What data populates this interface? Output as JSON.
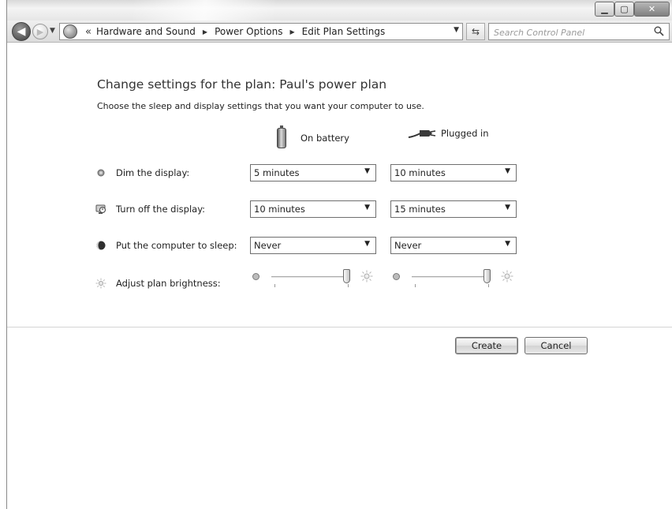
{
  "window": {
    "controls": {
      "minimize_icon": "minimize-icon",
      "maximize_icon": "maximize-icon",
      "close_icon": "close-icon"
    }
  },
  "nav": {
    "breadcrumb_prefix": "«",
    "breadcrumbs": [
      "Hardware and Sound",
      "Power Options",
      "Edit Plan Settings"
    ],
    "search_placeholder": "Search Control Panel"
  },
  "page": {
    "title": "Change settings for the plan: Paul's power plan",
    "subtitle": "Choose the sleep and display settings that you want your computer to use."
  },
  "columns": {
    "battery": "On battery",
    "plugged": "Plugged in"
  },
  "settings": [
    {
      "label": "Dim the display:",
      "battery": "5 minutes",
      "plugged": "10 minutes"
    },
    {
      "label": "Turn off the display:",
      "battery": "10 minutes",
      "plugged": "15 minutes"
    },
    {
      "label": "Put the computer to sleep:",
      "battery": "Never",
      "plugged": "Never"
    }
  ],
  "brightness": {
    "label": "Adjust plan brightness:",
    "battery_level": 1.0,
    "plugged_level": 1.0
  },
  "buttons": {
    "create": "Create",
    "cancel": "Cancel"
  }
}
